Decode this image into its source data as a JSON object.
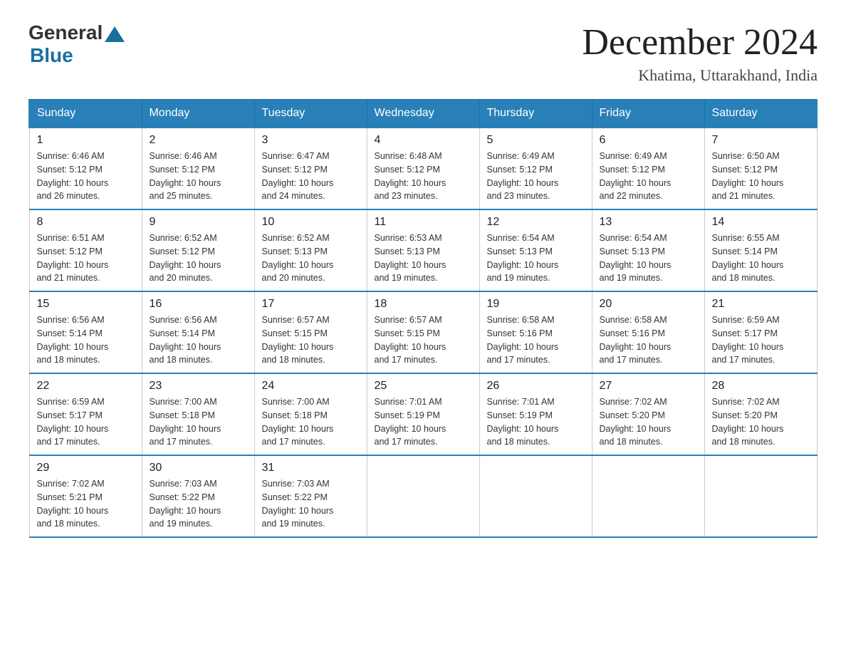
{
  "logo": {
    "general_text": "General",
    "blue_text": "Blue"
  },
  "title": "December 2024",
  "location": "Khatima, Uttarakhand, India",
  "days_of_week": [
    "Sunday",
    "Monday",
    "Tuesday",
    "Wednesday",
    "Thursday",
    "Friday",
    "Saturday"
  ],
  "weeks": [
    [
      {
        "day": "1",
        "sunrise": "6:46 AM",
        "sunset": "5:12 PM",
        "daylight": "10 hours and 26 minutes."
      },
      {
        "day": "2",
        "sunrise": "6:46 AM",
        "sunset": "5:12 PM",
        "daylight": "10 hours and 25 minutes."
      },
      {
        "day": "3",
        "sunrise": "6:47 AM",
        "sunset": "5:12 PM",
        "daylight": "10 hours and 24 minutes."
      },
      {
        "day": "4",
        "sunrise": "6:48 AM",
        "sunset": "5:12 PM",
        "daylight": "10 hours and 23 minutes."
      },
      {
        "day": "5",
        "sunrise": "6:49 AM",
        "sunset": "5:12 PM",
        "daylight": "10 hours and 23 minutes."
      },
      {
        "day": "6",
        "sunrise": "6:49 AM",
        "sunset": "5:12 PM",
        "daylight": "10 hours and 22 minutes."
      },
      {
        "day": "7",
        "sunrise": "6:50 AM",
        "sunset": "5:12 PM",
        "daylight": "10 hours and 21 minutes."
      }
    ],
    [
      {
        "day": "8",
        "sunrise": "6:51 AM",
        "sunset": "5:12 PM",
        "daylight": "10 hours and 21 minutes."
      },
      {
        "day": "9",
        "sunrise": "6:52 AM",
        "sunset": "5:12 PM",
        "daylight": "10 hours and 20 minutes."
      },
      {
        "day": "10",
        "sunrise": "6:52 AM",
        "sunset": "5:13 PM",
        "daylight": "10 hours and 20 minutes."
      },
      {
        "day": "11",
        "sunrise": "6:53 AM",
        "sunset": "5:13 PM",
        "daylight": "10 hours and 19 minutes."
      },
      {
        "day": "12",
        "sunrise": "6:54 AM",
        "sunset": "5:13 PM",
        "daylight": "10 hours and 19 minutes."
      },
      {
        "day": "13",
        "sunrise": "6:54 AM",
        "sunset": "5:13 PM",
        "daylight": "10 hours and 19 minutes."
      },
      {
        "day": "14",
        "sunrise": "6:55 AM",
        "sunset": "5:14 PM",
        "daylight": "10 hours and 18 minutes."
      }
    ],
    [
      {
        "day": "15",
        "sunrise": "6:56 AM",
        "sunset": "5:14 PM",
        "daylight": "10 hours and 18 minutes."
      },
      {
        "day": "16",
        "sunrise": "6:56 AM",
        "sunset": "5:14 PM",
        "daylight": "10 hours and 18 minutes."
      },
      {
        "day": "17",
        "sunrise": "6:57 AM",
        "sunset": "5:15 PM",
        "daylight": "10 hours and 18 minutes."
      },
      {
        "day": "18",
        "sunrise": "6:57 AM",
        "sunset": "5:15 PM",
        "daylight": "10 hours and 17 minutes."
      },
      {
        "day": "19",
        "sunrise": "6:58 AM",
        "sunset": "5:16 PM",
        "daylight": "10 hours and 17 minutes."
      },
      {
        "day": "20",
        "sunrise": "6:58 AM",
        "sunset": "5:16 PM",
        "daylight": "10 hours and 17 minutes."
      },
      {
        "day": "21",
        "sunrise": "6:59 AM",
        "sunset": "5:17 PM",
        "daylight": "10 hours and 17 minutes."
      }
    ],
    [
      {
        "day": "22",
        "sunrise": "6:59 AM",
        "sunset": "5:17 PM",
        "daylight": "10 hours and 17 minutes."
      },
      {
        "day": "23",
        "sunrise": "7:00 AM",
        "sunset": "5:18 PM",
        "daylight": "10 hours and 17 minutes."
      },
      {
        "day": "24",
        "sunrise": "7:00 AM",
        "sunset": "5:18 PM",
        "daylight": "10 hours and 17 minutes."
      },
      {
        "day": "25",
        "sunrise": "7:01 AM",
        "sunset": "5:19 PM",
        "daylight": "10 hours and 17 minutes."
      },
      {
        "day": "26",
        "sunrise": "7:01 AM",
        "sunset": "5:19 PM",
        "daylight": "10 hours and 18 minutes."
      },
      {
        "day": "27",
        "sunrise": "7:02 AM",
        "sunset": "5:20 PM",
        "daylight": "10 hours and 18 minutes."
      },
      {
        "day": "28",
        "sunrise": "7:02 AM",
        "sunset": "5:20 PM",
        "daylight": "10 hours and 18 minutes."
      }
    ],
    [
      {
        "day": "29",
        "sunrise": "7:02 AM",
        "sunset": "5:21 PM",
        "daylight": "10 hours and 18 minutes."
      },
      {
        "day": "30",
        "sunrise": "7:03 AM",
        "sunset": "5:22 PM",
        "daylight": "10 hours and 19 minutes."
      },
      {
        "day": "31",
        "sunrise": "7:03 AM",
        "sunset": "5:22 PM",
        "daylight": "10 hours and 19 minutes."
      },
      null,
      null,
      null,
      null
    ]
  ],
  "cell_labels": {
    "sunrise": "Sunrise:",
    "sunset": "Sunset:",
    "daylight": "Daylight:"
  }
}
